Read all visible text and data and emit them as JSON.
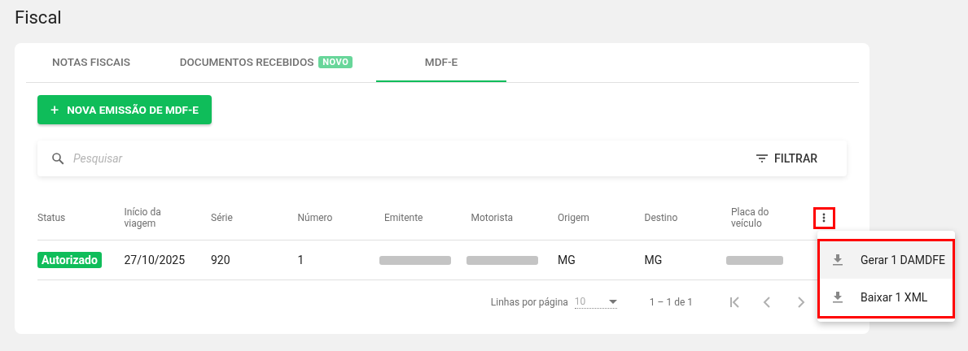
{
  "page_title": "Fiscal",
  "tabs": [
    {
      "label": "NOTAS FISCAIS",
      "selected": false
    },
    {
      "label": "DOCUMENTOS RECEBIDOS",
      "badge": "NOVO",
      "selected": false
    },
    {
      "label": "MDF-E",
      "selected": true
    }
  ],
  "new_button": {
    "icon": "+",
    "label": "NOVA EMISSÃO DE MDF-E"
  },
  "search": {
    "placeholder": "Pesquisar",
    "filter_label": "FILTRAR"
  },
  "table": {
    "columns": [
      "Status",
      "Início da viagem",
      "Série",
      "Número",
      "Emitente",
      "Motorista",
      "Origem",
      "Destino",
      "Placa do veículo"
    ],
    "rows": [
      {
        "cells": [
          {
            "kind": "status",
            "text": "Autorizado"
          },
          {
            "kind": "text",
            "text": "27/10/2025"
          },
          {
            "kind": "text",
            "text": "920"
          },
          {
            "kind": "text",
            "text": "1"
          },
          {
            "kind": "redacted"
          },
          {
            "kind": "redacted"
          },
          {
            "kind": "text",
            "text": "MG"
          },
          {
            "kind": "text",
            "text": "MG"
          },
          {
            "kind": "redacted"
          }
        ]
      }
    ]
  },
  "pagination": {
    "rows_label": "Linhas por página",
    "rows_value": "10",
    "range": "1 – 1 de 1"
  },
  "menu": {
    "items": [
      {
        "label": "Gerar 1 DAMDFE",
        "selected": true
      },
      {
        "label": "Baixar 1 XML",
        "selected": false
      }
    ]
  }
}
